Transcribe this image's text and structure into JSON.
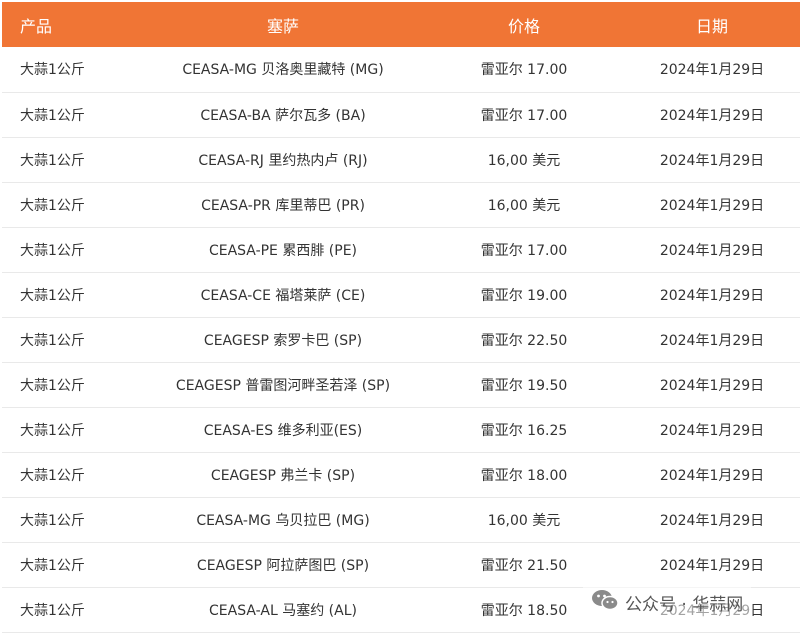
{
  "header": {
    "product": "产品",
    "market": "塞萨",
    "price": "价格",
    "date": "日期"
  },
  "rows": [
    {
      "product": "大蒜1公斤",
      "market": "CEASA-MG 贝洛奥里藏特 (MG)",
      "price": "雷亚尔 17.00",
      "date": "2024年1月29日"
    },
    {
      "product": "大蒜1公斤",
      "market": "CEASA-BA 萨尔瓦多 (BA)",
      "price": "雷亚尔 17.00",
      "date": "2024年1月29日"
    },
    {
      "product": "大蒜1公斤",
      "market": "CEASA-RJ 里约热内卢 (RJ)",
      "price": "16,00 美元",
      "date": "2024年1月29日"
    },
    {
      "product": "大蒜1公斤",
      "market": "CEASA-PR 库里蒂巴 (PR)",
      "price": "16,00 美元",
      "date": "2024年1月29日"
    },
    {
      "product": "大蒜1公斤",
      "market": "CEASA-PE 累西腓 (PE)",
      "price": "雷亚尔 17.00",
      "date": "2024年1月29日"
    },
    {
      "product": "大蒜1公斤",
      "market": "CEASA-CE 福塔莱萨 (CE)",
      "price": "雷亚尔 19.00",
      "date": "2024年1月29日"
    },
    {
      "product": "大蒜1公斤",
      "market": "CEAGESP 索罗卡巴 (SP)",
      "price": "雷亚尔 22.50",
      "date": "2024年1月29日"
    },
    {
      "product": "大蒜1公斤",
      "market": "CEAGESP 普雷图河畔圣若泽 (SP)",
      "price": "雷亚尔 19.50",
      "date": "2024年1月29日"
    },
    {
      "product": "大蒜1公斤",
      "market": "CEASA-ES 维多利亚(ES)",
      "price": "雷亚尔 16.25",
      "date": "2024年1月29日"
    },
    {
      "product": "大蒜1公斤",
      "market": "CEAGESP 弗兰卡 (SP)",
      "price": "雷亚尔 18.00",
      "date": "2024年1月29日"
    },
    {
      "product": "大蒜1公斤",
      "market": "CEASA-MG 乌贝拉巴 (MG)",
      "price": "16,00 美元",
      "date": "2024年1月29日"
    },
    {
      "product": "大蒜1公斤",
      "market": "CEAGESP 阿拉萨图巴 (SP)",
      "price": "雷亚尔 21.50",
      "date": "2024年1月29日"
    },
    {
      "product": "大蒜1公斤",
      "market": "CEASA-AL 马塞约 (AL)",
      "price": "雷亚尔 18.50",
      "date": "2024年1月29日"
    }
  ],
  "watermark": {
    "icon": "wechat-icon",
    "text": "公众号 · 华蒜网"
  },
  "colors": {
    "header_background": "#f07535",
    "header_text": "#ffffff",
    "row_divider": "#e9e9e9"
  }
}
